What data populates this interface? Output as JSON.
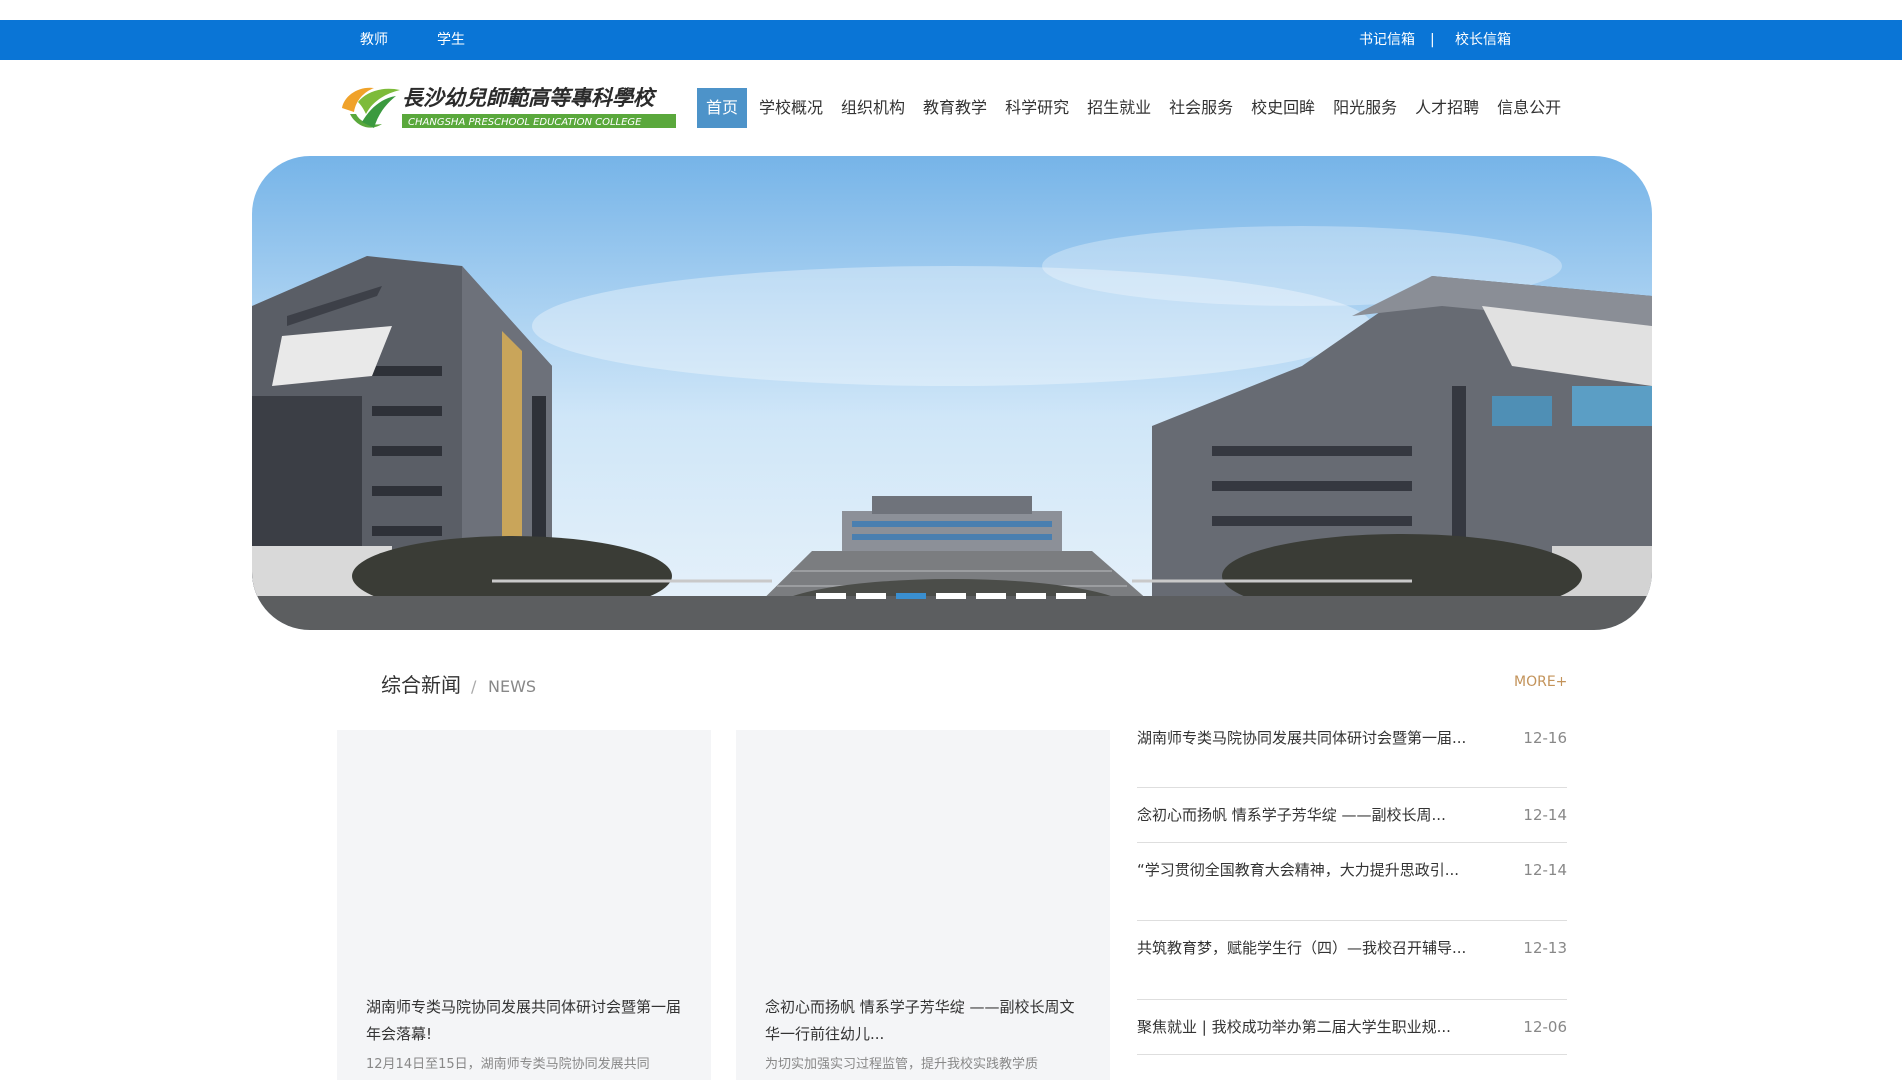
{
  "topbar": {
    "teacher": "教师",
    "student": "学生",
    "secretary_mailbox": "书记信箱",
    "separator": "|",
    "principal_mailbox": "校长信箱"
  },
  "logo": {
    "cn_name": "長沙幼兒師範高等專科學校",
    "en_name": "CHANGSHA PRESCHOOL EDUCATION COLLEGE"
  },
  "nav": {
    "items": [
      "首页",
      "学校概况",
      "组织机构",
      "教育教学",
      "科学研究",
      "招生就业",
      "社会服务",
      "校史回眸",
      "阳光服务",
      "人才招聘",
      "信息公开"
    ]
  },
  "banner": {
    "slide_count": 7,
    "active_slide": 3
  },
  "news": {
    "title": "综合新闻",
    "separator": "/",
    "title_en": "NEWS",
    "more": "MORE+",
    "cards": [
      {
        "title": "湖南师专类马院协同发展共同体研讨会暨第一届年会落幕!",
        "desc": "12月14日至15日，湖南师专类马院协同发展共同"
      },
      {
        "title": "念初心而扬帆 情系学子芳华绽 ——副校长周文华一行前往幼儿...",
        "desc": "为切实加强实习过程监管，提升我校实践教学质"
      }
    ],
    "list": [
      {
        "title": "湖南师专类马院协同发展共同体研讨会暨第一届...",
        "date": "12-16"
      },
      {
        "title": "念初心而扬帆 情系学子芳华绽 ——副校长周...",
        "date": "12-14"
      },
      {
        "title": "“学习贯彻全国教育大会精神，大力提升思政引...",
        "date": "12-14"
      },
      {
        "title": "共筑教育梦，赋能学生行（四）—我校召开辅导...",
        "date": "12-13"
      },
      {
        "title": "聚焦就业 | 我校成功举办第二届大学生职业规...",
        "date": "12-06"
      }
    ]
  },
  "colors": {
    "topbar_bg": "#0a75d6",
    "nav_active_bg": "#4d93c9",
    "more_link": "#c3935a",
    "card_bg": "#f4f5f7"
  }
}
